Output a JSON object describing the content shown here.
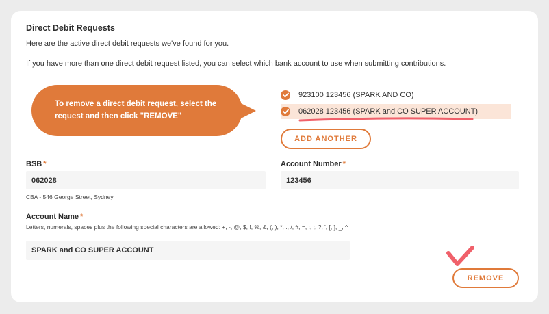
{
  "section": {
    "title": "Direct Debit Requests",
    "intro": "Here are the active direct debit requests we've found for you.",
    "help": "If you have more than one direct debit request listed, you can select which bank account to use when submitting contributions."
  },
  "callout": {
    "text": "To remove a direct debit request, select the request and then click \"REMOVE\""
  },
  "requests": [
    {
      "label": "923100 123456 (SPARK AND CO)",
      "selected": false
    },
    {
      "label": "062028 123456 (SPARK and CO SUPER ACCOUNT)",
      "selected": true
    }
  ],
  "buttons": {
    "add_another": "ADD ANOTHER",
    "remove": "REMOVE"
  },
  "form": {
    "required_mark": "*",
    "bsb": {
      "label": "BSB",
      "value": "062028",
      "hint": "CBA - 546 George Street, Sydney"
    },
    "account_number": {
      "label": "Account Number",
      "value": "123456"
    },
    "account_name": {
      "label": "Account Name",
      "hint": "Letters, numerals, spaces plus the following special characters are allowed: +, -, @, $, !, %, &, (, ), *, ., /, #, =, :, ;, ?, ', [, ], _, ^",
      "value": "SPARK and CO SUPER ACCOUNT"
    }
  },
  "colors": {
    "accent": "#e07a3a",
    "highlight": "#fbe5d8",
    "annotation": "#f0606a"
  }
}
